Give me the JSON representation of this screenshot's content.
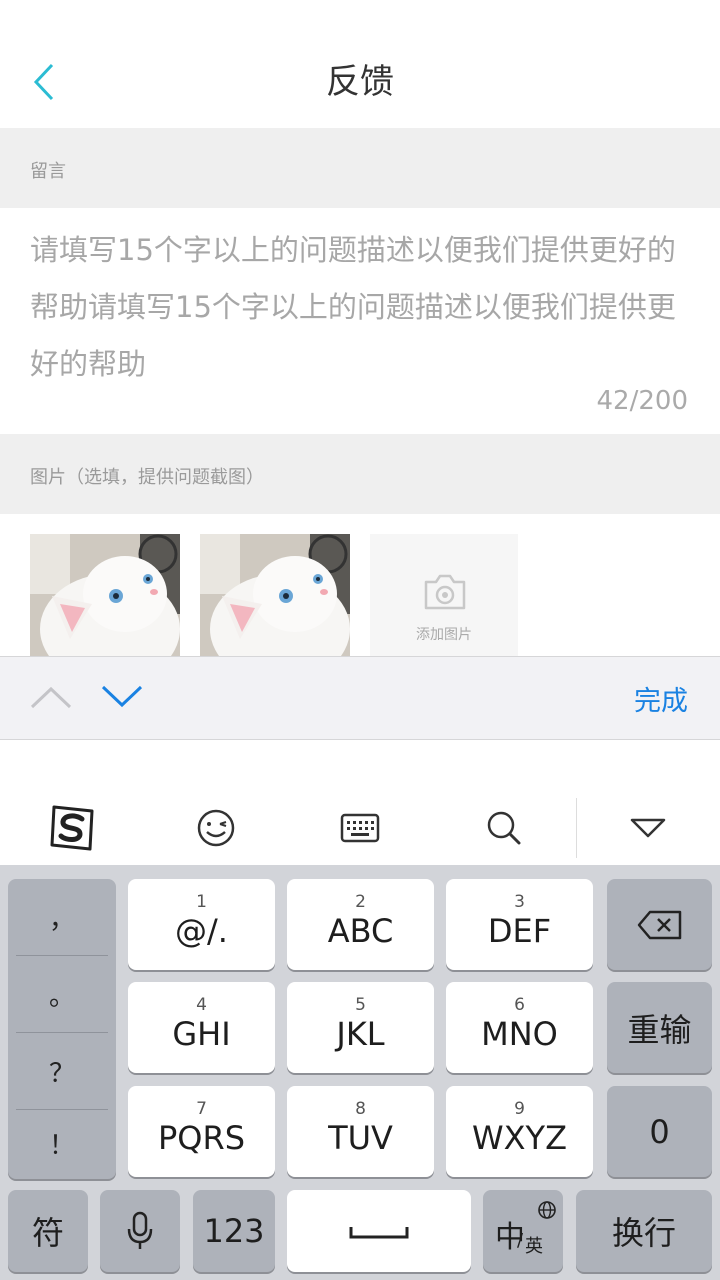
{
  "header": {
    "title": "反馈",
    "back_icon": "chevron-left-icon",
    "accent": "#2bbcd3"
  },
  "message_section": {
    "label": "留言",
    "text": "请填写15个字以上的问题描述以便我们提供更好的帮助请填写15个字以上的问题描述以便我们提供更好的帮助",
    "count": "42/200"
  },
  "image_section": {
    "label": "图片（选填，提供问题截图）",
    "thumbnails": [
      "cat-photo",
      "cat-photo"
    ],
    "add_label": "添加图片"
  },
  "accessory_bar": {
    "done_label": "完成",
    "done_color": "#1a82e2"
  },
  "ime_toolbar": [
    "sogou-logo-icon",
    "emoji-icon",
    "keyboard-icon",
    "search-icon",
    "collapse-icon"
  ],
  "keyboard": {
    "punct": [
      "，",
      "。",
      "？",
      "！"
    ],
    "keys": [
      {
        "num": "1",
        "letters": "@/."
      },
      {
        "num": "2",
        "letters": "ABC"
      },
      {
        "num": "3",
        "letters": "DEF"
      },
      {
        "num": "4",
        "letters": "GHI"
      },
      {
        "num": "5",
        "letters": "JKL"
      },
      {
        "num": "6",
        "letters": "MNO"
      },
      {
        "num": "7",
        "letters": "PQRS"
      },
      {
        "num": "8",
        "letters": "TUV"
      },
      {
        "num": "9",
        "letters": "WXYZ"
      }
    ],
    "retype": "重输",
    "zero": "0",
    "symbols": "符",
    "num_mode": "123",
    "lang_main": "中",
    "lang_sub": "英",
    "enter": "换行"
  }
}
